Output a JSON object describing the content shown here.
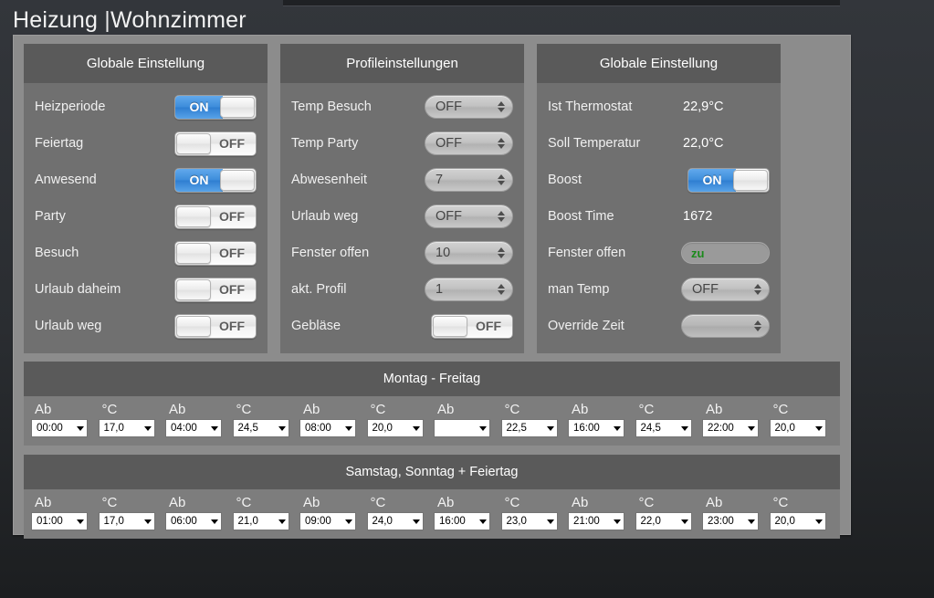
{
  "page": {
    "title_main": "Heizung ",
    "title_sep": "|",
    "title_room": "Wohnzimmer"
  },
  "panels": [
    {
      "header": "Globale Einstellung",
      "rows": [
        {
          "label": "Heizperiode",
          "type": "toggle",
          "state": "ON"
        },
        {
          "label": "Feiertag",
          "type": "toggle",
          "state": "OFF"
        },
        {
          "label": "Anwesend",
          "type": "toggle",
          "state": "ON"
        },
        {
          "label": "Party",
          "type": "toggle",
          "state": "OFF"
        },
        {
          "label": "Besuch",
          "type": "toggle",
          "state": "OFF"
        },
        {
          "label": "Urlaub daheim",
          "type": "toggle",
          "state": "OFF"
        },
        {
          "label": "Urlaub weg",
          "type": "toggle",
          "state": "OFF"
        }
      ]
    },
    {
      "header": "Profileinstellungen",
      "rows": [
        {
          "label": "Temp Besuch",
          "type": "select",
          "value": "OFF"
        },
        {
          "label": "Temp Party",
          "type": "select",
          "value": "OFF"
        },
        {
          "label": "Abwesenheit",
          "type": "select",
          "value": "7"
        },
        {
          "label": "Urlaub weg",
          "type": "select",
          "value": "OFF"
        },
        {
          "label": "Fenster offen",
          "type": "select",
          "value": "10"
        },
        {
          "label": "akt. Profil",
          "type": "select",
          "value": "1"
        },
        {
          "label": "Gebläse",
          "type": "toggle",
          "state": "OFF"
        }
      ]
    },
    {
      "header": "Globale Einstellung",
      "rows": [
        {
          "label": "Ist Thermostat",
          "type": "text",
          "value": "22,9°C"
        },
        {
          "label": "Soll Temperatur",
          "type": "text",
          "value": "22,0°C"
        },
        {
          "label": "Boost",
          "type": "toggle",
          "state": "ON"
        },
        {
          "label": "Boost Time",
          "type": "text",
          "value": "1672"
        },
        {
          "label": "Fenster offen",
          "type": "state",
          "value": "zu"
        },
        {
          "label": "man Temp",
          "type": "select",
          "value": "OFF"
        },
        {
          "label": "Override Zeit",
          "type": "select",
          "value": ""
        }
      ]
    }
  ],
  "schedules": [
    {
      "header": "Montag - Freitag",
      "col_time_header": "Ab",
      "col_temp_header": "°C",
      "entries": [
        {
          "time": "00:00",
          "temp": "17,0"
        },
        {
          "time": "04:00",
          "temp": "24,5"
        },
        {
          "time": "08:00",
          "temp": "20,0"
        },
        {
          "time": "",
          "temp": "22,5"
        },
        {
          "time": "16:00",
          "temp": "24,5"
        },
        {
          "time": "22:00",
          "temp": "20,0"
        }
      ]
    },
    {
      "header": "Samstag, Sonntag + Feiertag",
      "col_time_header": "Ab",
      "col_temp_header": "°C",
      "entries": [
        {
          "time": "01:00",
          "temp": "17,0"
        },
        {
          "time": "06:00",
          "temp": "21,0"
        },
        {
          "time": "09:00",
          "temp": "24,0"
        },
        {
          "time": "16:00",
          "temp": "23,0"
        },
        {
          "time": "21:00",
          "temp": "22,0"
        },
        {
          "time": "23:00",
          "temp": "20,0"
        }
      ]
    }
  ],
  "colors": {
    "accent_on": "#3d8ddb",
    "panel_bg": "#707070",
    "panel_header_bg": "#5a5a5a",
    "container_bg": "#8c8c8c",
    "status_ok": "#1a8a1a"
  }
}
